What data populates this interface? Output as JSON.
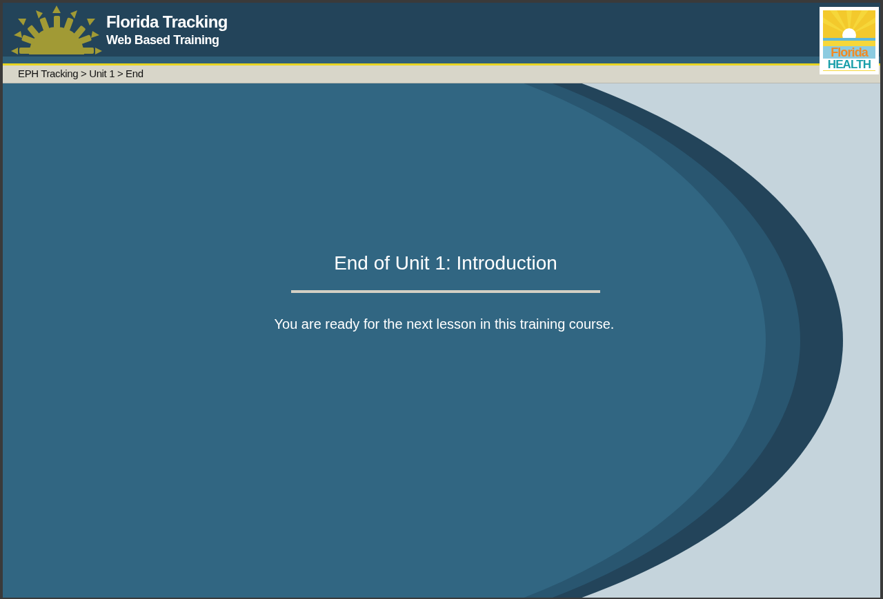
{
  "header": {
    "title": "Florida Tracking",
    "subtitle": "Web Based Training",
    "logo": {
      "line_1": "Florida",
      "line_2": "HEALTH"
    }
  },
  "breadcrumb": "EPH Tracking > Unit 1 > End",
  "slide": {
    "heading": "End of Unit 1: Introduction",
    "message": "You are ready for the next lesson in this training course."
  }
}
